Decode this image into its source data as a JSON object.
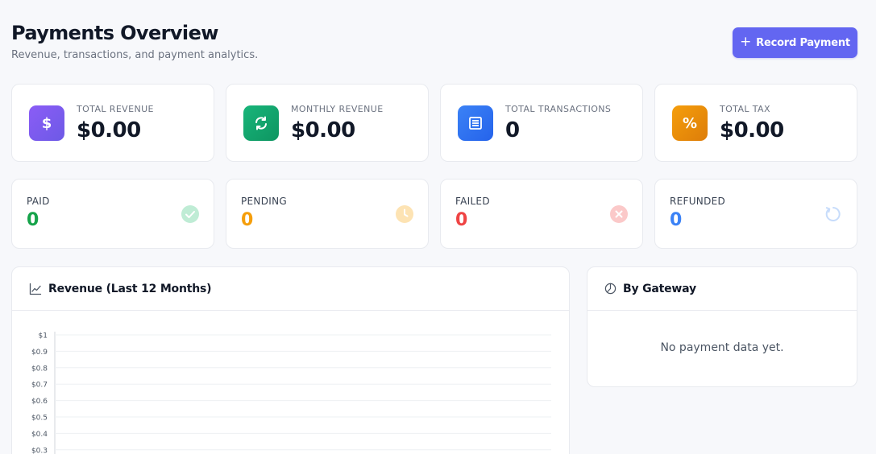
{
  "header": {
    "title": "Payments Overview",
    "subtitle": "Revenue, transactions, and payment analytics.",
    "record_button": "Record Payment"
  },
  "stats": [
    {
      "label": "TOTAL REVENUE",
      "value": "$0.00",
      "icon": "dollar-icon",
      "color": "#7c5cf2"
    },
    {
      "label": "MONTHLY REVENUE",
      "value": "$0.00",
      "icon": "refresh-icon",
      "color": "#10a36b"
    },
    {
      "label": "TOTAL TRANSACTIONS",
      "value": "0",
      "icon": "receipt-icon",
      "color": "#2f6fe8"
    },
    {
      "label": "TOTAL TAX",
      "value": "$0.00",
      "icon": "percent-icon",
      "color": "#e88a0c"
    }
  ],
  "statuses": [
    {
      "label": "PAID",
      "value": "0",
      "color": "#16a34a",
      "icon": "check-circle-icon"
    },
    {
      "label": "PENDING",
      "value": "0",
      "color": "#f59e0b",
      "icon": "clock-icon"
    },
    {
      "label": "FAILED",
      "value": "0",
      "color": "#ef4444",
      "icon": "x-circle-icon"
    },
    {
      "label": "REFUNDED",
      "value": "0",
      "color": "#3b82f6",
      "icon": "undo-icon"
    }
  ],
  "revenue_panel": {
    "title": "Revenue (Last 12 Months)",
    "icon": "line-chart-icon"
  },
  "gateway_panel": {
    "title": "By Gateway",
    "icon": "pie-chart-icon",
    "empty_text": "No payment data yet."
  },
  "chart_data": {
    "type": "line",
    "title": "Revenue (Last 12 Months)",
    "xlabel": "",
    "ylabel": "",
    "y_tick_labels": [
      "$1",
      "$0.9",
      "$0.8",
      "$0.7",
      "$0.6",
      "$0.5",
      "$0.4",
      "$0.3"
    ],
    "ylim": [
      0,
      1
    ],
    "series": [],
    "grid": true
  }
}
